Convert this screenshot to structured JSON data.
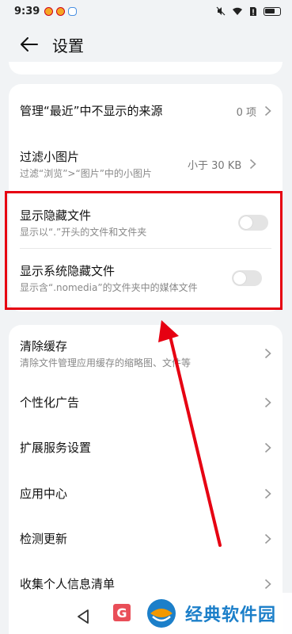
{
  "status_bar": {
    "time": "9:39"
  },
  "header": {
    "title": "设置"
  },
  "sections": {
    "recent_sources": {
      "title": "管理“最近”中不显示的来源",
      "value": "0 项"
    },
    "filter_images": {
      "title": "过滤小图片",
      "subtitle": "过滤“浏览”>“图片”中的小图片",
      "value": "小于 30 KB"
    },
    "show_hidden": {
      "title": "显示隐藏文件",
      "subtitle": "显示以“.”开头的文件和文件夹",
      "enabled": false
    },
    "show_system_hidden": {
      "title": "显示系统隐藏文件",
      "subtitle": "显示含“.nomedia”的文件夹中的媒体文件",
      "enabled": false
    },
    "clear_cache": {
      "title": "清除缓存",
      "subtitle": "清除文件管理应用缓存的缩略图、文件等"
    },
    "personalized_ads": {
      "title": "个性化广告"
    },
    "extension_services": {
      "title": "扩展服务设置"
    },
    "app_center": {
      "title": "应用中心"
    },
    "check_update": {
      "title": "检测更新"
    },
    "personal_info_list": {
      "title": "收集个人信息清单"
    }
  },
  "watermark": {
    "text": "经典软件园",
    "badge": "G"
  },
  "colors": {
    "highlight": "#e60012",
    "brand": "#1c7fc9"
  },
  "icons": [
    "back-arrow-icon",
    "chevron-right-icon",
    "toggle-switch",
    "nav-back-icon",
    "watermark-logo-icon"
  ]
}
